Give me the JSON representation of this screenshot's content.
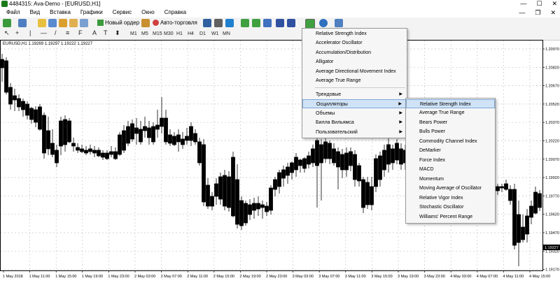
{
  "window": {
    "title": "4484315: Ava-Demo - [EURUSD,H1]",
    "controls": [
      "—",
      "☐",
      "✕"
    ]
  },
  "menubar": {
    "items": [
      "Файл",
      "Вид",
      "Вставка",
      "Графики",
      "Сервис",
      "Окно",
      "Справка"
    ],
    "right_controls": [
      "—",
      "❐",
      "✕"
    ]
  },
  "toolbar": {
    "new_order_label": "Новый ордер",
    "auto_trading_label": "Авто-торговля",
    "timeframes": [
      "M1",
      "M5",
      "M15",
      "M30",
      "H1",
      "H4",
      "D1",
      "W1",
      "MN"
    ]
  },
  "chart": {
    "symbol_info": "EURUSD,H1  1.19269 1.19297 1.19222 1.19227",
    "price_labels": [
      "1.20970",
      "1.20820",
      "1.20670",
      "1.20520",
      "1.20370",
      "1.20220",
      "1.20070",
      "1.19920",
      "1.19770",
      "1.19620",
      "1.19470",
      "1.19320",
      "1.19170"
    ],
    "time_labels": [
      "1 May 2018",
      "1 May 11:00",
      "1 May 15:00",
      "1 May 19:00",
      "1 May 23:00",
      "2 May 03:00",
      "2 May 07:00",
      "2 May 11:00",
      "2 May 15:00",
      "2 May 19:00",
      "2 May 23:00",
      "3 May 03:00",
      "3 May 07:00",
      "3 May 11:00",
      "3 May 15:00",
      "3 May 19:00",
      "3 May 23:00",
      "4 May 03:00",
      "4 May 07:00",
      "4 May 11:00",
      "4 May 15:00"
    ],
    "current_price_label": "1.19227",
    "colors": {
      "bull": "#ffffff",
      "bear": "#000000",
      "grid": "#c8c8c8",
      "current_price_bg": "#000000"
    }
  },
  "indicators_menu": {
    "top_items": [
      "Relative Strength Index",
      "Accelerator Oscillator",
      "Accumulation/Distribution",
      "Alligator",
      "Average Directional Movement Index",
      "Average True Range"
    ],
    "groups": [
      "Трендовые",
      "Осцилляторы",
      "Объемы",
      "Билла Вильямса",
      "Пользовательский"
    ],
    "highlighted_group": "Осцилляторы"
  },
  "oscillators_submenu": {
    "items": [
      "Relative Strength Index",
      "Average True Range",
      "Bears Power",
      "Bulls Power",
      "Commodity Channel Index",
      "DeMarker",
      "Force Index",
      "MACD",
      "Momentum",
      "Moving Average of Oscillator",
      "Relative Vigor Index",
      "Stochastic Oscillator",
      "Williams' Percent Range"
    ],
    "highlighted": "Relative Strength Index"
  }
}
